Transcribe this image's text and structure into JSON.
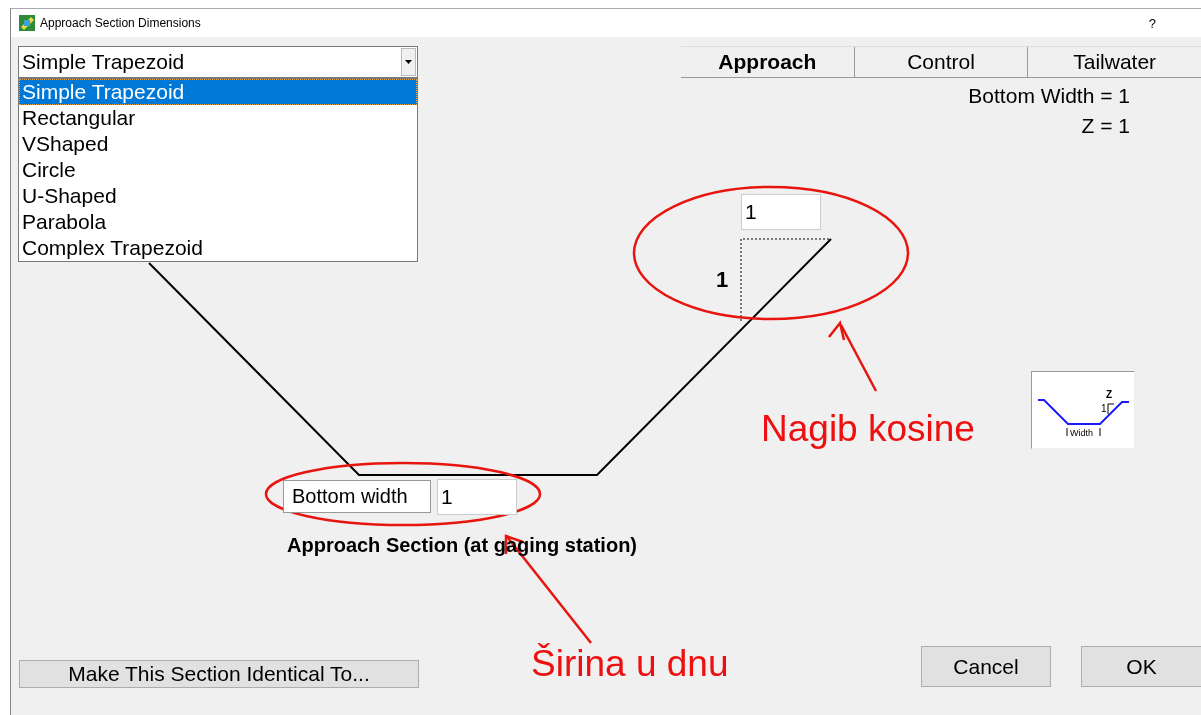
{
  "window": {
    "title": "Approach Section Dimensions",
    "help": "?"
  },
  "shape_selector": {
    "value": "Simple Trapezoid",
    "options": [
      {
        "label": "Simple Trapezoid",
        "selected": true
      },
      {
        "label": "Rectangular",
        "selected": false
      },
      {
        "label": "VShaped",
        "selected": false
      },
      {
        "label": "Circle",
        "selected": false
      },
      {
        "label": "U-Shaped",
        "selected": false
      },
      {
        "label": "Parabola",
        "selected": false
      },
      {
        "label": "Complex Trapezoid",
        "selected": false
      }
    ]
  },
  "tabs": [
    {
      "label": "Approach",
      "selected": true
    },
    {
      "label": "Control",
      "selected": false
    },
    {
      "label": "Tailwater",
      "selected": false
    }
  ],
  "summary": [
    "Bottom Width = 1",
    "Z = 1"
  ],
  "diagram": {
    "slope_input": "1",
    "rise_label": "1",
    "bottom_width_label": "Bottom width",
    "bottom_width_input": "1",
    "caption": "Approach Section (at gaging station)"
  },
  "legend_icon": {
    "z_label": "Z",
    "rise_label": "1",
    "width_label": "Width"
  },
  "annotations": [
    "Nagib kosine",
    "Širina u dnu"
  ],
  "buttons": {
    "identical": "Make This Section Identical To...",
    "cancel": "Cancel",
    "ok": "OK"
  }
}
